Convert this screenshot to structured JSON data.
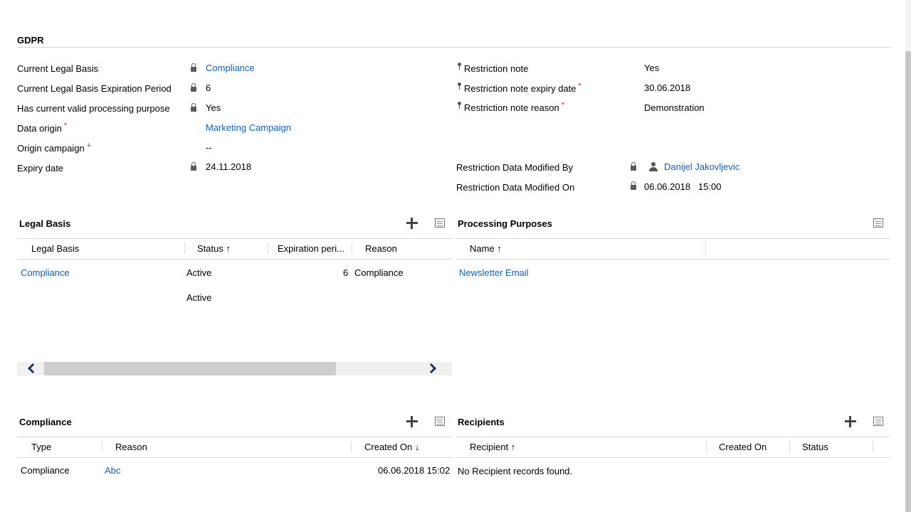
{
  "section_title": "GDPR",
  "left_fields": [
    {
      "label": "Current Legal Basis",
      "value": "Compliance",
      "required": "",
      "recommended": ""
    },
    {
      "label": "Current Legal Basis Expiration Period",
      "value": "6",
      "required": "",
      "recommended": ""
    },
    {
      "label": "Has current valid processing purpose",
      "value": "Yes",
      "required": "",
      "recommended": ""
    },
    {
      "label": "Data origin",
      "value": "Marketing Campaign",
      "required": "*",
      "recommended": ""
    },
    {
      "label": "Origin campaign",
      "value": "--",
      "required": "",
      "recommended": "+"
    },
    {
      "label": "Expiry date",
      "value": "24.11.2018",
      "required": "",
      "recommended": ""
    }
  ],
  "right_fields": [
    {
      "label": "Restriction note",
      "value": "Yes",
      "required": ""
    },
    {
      "label": "Restriction note expiry date",
      "value": "30.06.2018",
      "required": "*"
    },
    {
      "label": "Restriction note reason",
      "value": "Demonstration",
      "required": "*"
    },
    {
      "label": "Restriction Data Modified By",
      "value": "Danijel Jakovljevic",
      "required": ""
    },
    {
      "label": "Restriction Data Modified On",
      "value": "06.06.2018   15:00",
      "required": ""
    }
  ],
  "legal_basis": {
    "title": "Legal Basis",
    "columns": [
      "Legal Basis",
      "Status ↑",
      "Expiration peri...",
      "Reason"
    ],
    "rows": [
      {
        "legal_basis": "Compliance",
        "status": "Active",
        "expiration": "6",
        "reason": "Compliance"
      },
      {
        "legal_basis": "",
        "status": "Active",
        "expiration": "",
        "reason": ""
      }
    ]
  },
  "processing_purposes": {
    "title": "Processing Purposes",
    "columns": [
      "Name ↑"
    ],
    "rows": [
      {
        "name": "Newsletter Email"
      }
    ]
  },
  "compliance": {
    "title": "Compliance",
    "columns": [
      "Type",
      "Reason",
      "Created On ↓"
    ],
    "rows": [
      {
        "type": "Compliance",
        "reason": "Abc",
        "created_on": "06.06.2018 15:02"
      }
    ]
  },
  "recipients": {
    "title": "Recipients",
    "columns": [
      "Recipient ↑",
      "Created On",
      "Status"
    ],
    "empty_message": "No Recipient records found."
  },
  "colors": {
    "link": "#1160b7",
    "required": "#e01b1b"
  },
  "icons": [
    "lock-icon",
    "key-icon",
    "person-icon",
    "add-icon",
    "grid-view-icon",
    "chevron-left-icon",
    "chevron-right-icon"
  ]
}
